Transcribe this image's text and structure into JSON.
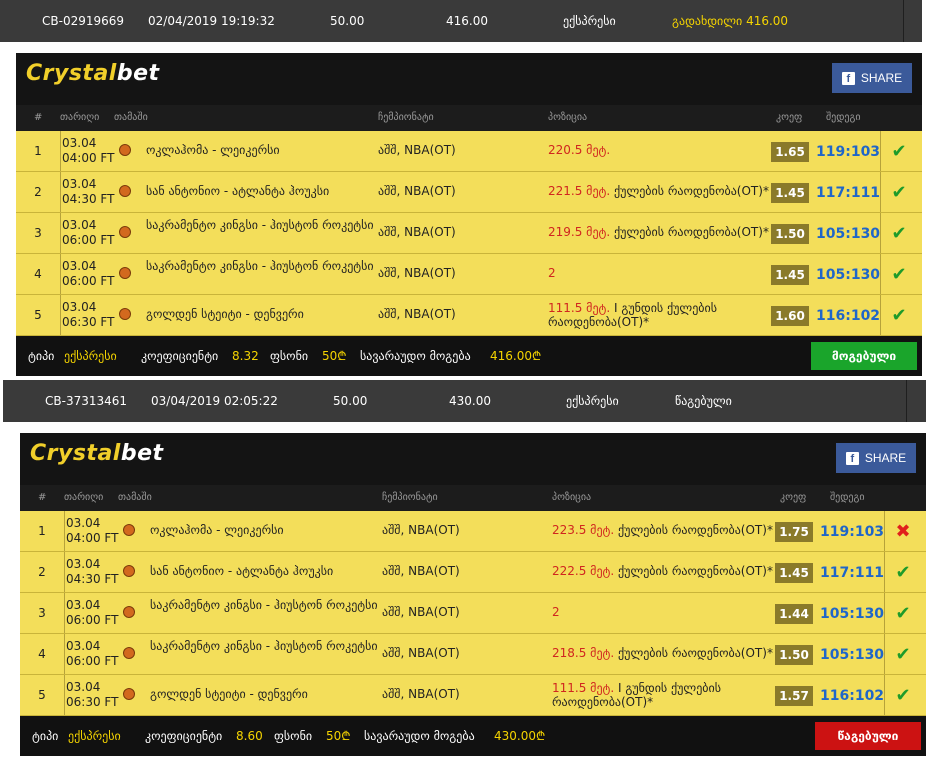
{
  "tickets": [
    {
      "header": {
        "id": "CB-02919669",
        "datetime": "02/04/2019 19:19:32",
        "stake": "50.00",
        "payout": "416.00",
        "type": "ექსპრესი",
        "status": "გადახდილი 416.00"
      },
      "brand": {
        "part1": "Crystal",
        "part2": "bet"
      },
      "share_label": "SHARE",
      "columns": {
        "num": "#",
        "date": "თარიღი",
        "game": "თამაში",
        "league": "ჩემპიონატი",
        "position": "პოზიცია",
        "odds": "კოეფ",
        "result": "შედეგი"
      },
      "rows": [
        {
          "num": "1",
          "date_line1": "03.04",
          "date_line2": "04:00 FT",
          "game": "ოკლაჰომა - ლეიკერსი",
          "league": "აშშ, NBA(OT)",
          "pos_value": "220.5 მეტ.",
          "pos_text": "",
          "odd": "1.65",
          "score": "119:103",
          "result": "win"
        },
        {
          "num": "2",
          "date_line1": "03.04",
          "date_line2": "04:30 FT",
          "game": "სან ანტონიო - ატლანტა ჰოუკსი",
          "league": "აშშ, NBA(OT)",
          "pos_value": "221.5 მეტ.",
          "pos_text": " ქულების რაოდენობა(OT)*",
          "odd": "1.45",
          "score": "117:111",
          "result": "win"
        },
        {
          "num": "3",
          "date_line1": "03.04",
          "date_line2": "06:00 FT",
          "game": "საკრამენტო კინგსი - ჰიუსტონ როკეტსი",
          "league": "აშშ, NBA(OT)",
          "pos_value": "219.5 მეტ.",
          "pos_text": " ქულების რაოდენობა(OT)*",
          "odd": "1.50",
          "score": "105:130",
          "result": "win"
        },
        {
          "num": "4",
          "date_line1": "03.04",
          "date_line2": "06:00 FT",
          "game": "საკრამენტო კინგსი - ჰიუსტონ როკეტსი",
          "league": "აშშ, NBA(OT)",
          "pos_value": "2",
          "pos_text": "",
          "odd": "1.45",
          "score": "105:130",
          "result": "win"
        },
        {
          "num": "5",
          "date_line1": "03.04",
          "date_line2": "06:30 FT",
          "game": "გოლდენ სტეიტი - დენვერი",
          "league": "აშშ, NBA(OT)",
          "pos_value": "111.5 მეტ.",
          "pos_text": " I გუნდის ქულების რაოდენობა(OT)*",
          "odd": "1.60",
          "score": "116:102",
          "result": "win"
        }
      ],
      "footer": {
        "type_label": "ტიპი",
        "type_value": "ექსპრესი",
        "coef_label": "კოეფიციენტი",
        "coef_value": "8.32",
        "stake_label": "ფსონი",
        "stake_value": "50₾",
        "payout_label": "სავარაუდო მოგება",
        "payout_value": "416.00₾",
        "status_label": "მოგებული",
        "status_color": "#1aa52b"
      }
    },
    {
      "header": {
        "id": "CB-37313461",
        "datetime": "03/04/2019 02:05:22",
        "stake": "50.00",
        "payout": "430.00",
        "type": "ექსპრესი",
        "status": "წაგებული"
      },
      "brand": {
        "part1": "Crystal",
        "part2": "bet"
      },
      "share_label": "SHARE",
      "columns": {
        "num": "#",
        "date": "თარიღი",
        "game": "თამაში",
        "league": "ჩემპიონატი",
        "position": "პოზიცია",
        "odds": "კოეფ",
        "result": "შედეგი"
      },
      "rows": [
        {
          "num": "1",
          "date_line1": "03.04",
          "date_line2": "04:00 FT",
          "game": "ოკლაჰომა - ლეიკერსი",
          "league": "აშშ, NBA(OT)",
          "pos_value": "223.5 მეტ.",
          "pos_text": " ქულების რაოდენობა(OT)*",
          "odd": "1.75",
          "score": "119:103",
          "result": "lose"
        },
        {
          "num": "2",
          "date_line1": "03.04",
          "date_line2": "04:30 FT",
          "game": "სან ანტონიო - ატლანტა ჰოუკსი",
          "league": "აშშ, NBA(OT)",
          "pos_value": "222.5 მეტ.",
          "pos_text": " ქულების რაოდენობა(OT)*",
          "odd": "1.45",
          "score": "117:111",
          "result": "win"
        },
        {
          "num": "3",
          "date_line1": "03.04",
          "date_line2": "06:00 FT",
          "game": "საკრამენტო კინგსი - ჰიუსტონ როკეტსი",
          "league": "აშშ, NBA(OT)",
          "pos_value": "2",
          "pos_text": "",
          "odd": "1.44",
          "score": "105:130",
          "result": "win"
        },
        {
          "num": "4",
          "date_line1": "03.04",
          "date_line2": "06:00 FT",
          "game": "საკრამენტო კინგსი - ჰიუსტონ როკეტსი",
          "league": "აშშ, NBA(OT)",
          "pos_value": "218.5 მეტ.",
          "pos_text": " ქულების რაოდენობა(OT)*",
          "odd": "1.50",
          "score": "105:130",
          "result": "win"
        },
        {
          "num": "5",
          "date_line1": "03.04",
          "date_line2": "06:30 FT",
          "game": "გოლდენ სტეიტი - დენვერი",
          "league": "აშშ, NBA(OT)",
          "pos_value": "111.5 მეტ.",
          "pos_text": " I გუნდის ქულების რაოდენობა(OT)*",
          "odd": "1.57",
          "score": "116:102",
          "result": "win"
        }
      ],
      "footer": {
        "type_label": "ტიპი",
        "type_value": "ექსპრესი",
        "coef_label": "კოეფიციენტი",
        "coef_value": "8.60",
        "stake_label": "ფსონი",
        "stake_value": "50₾",
        "payout_label": "სავარაუდო მოგება",
        "payout_value": "430.00₾",
        "status_label": "წაგებული",
        "status_color": "#cc1212"
      }
    }
  ],
  "icons": {
    "win": "check-icon",
    "lose": "cross-icon",
    "sport": "basketball-icon",
    "share": "facebook-icon"
  }
}
